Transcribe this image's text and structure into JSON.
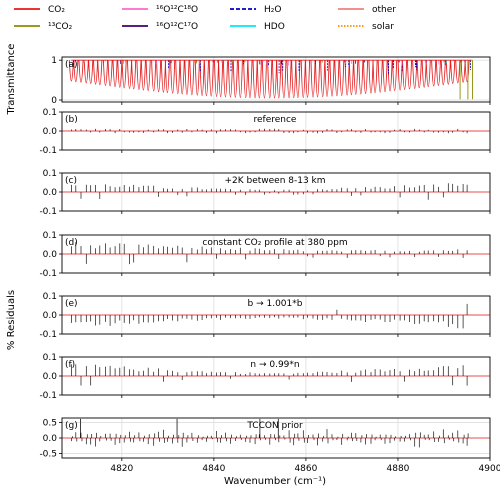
{
  "chart_data": {
    "type": "line",
    "legend": {
      "position": "top",
      "entries": [
        {
          "label": "CO₂",
          "color": "#e41a1c",
          "style": "solid"
        },
        {
          "label": "¹³CO₂",
          "color": "#8c8c00",
          "style": "solid"
        },
        {
          "label": "¹⁶O¹²C¹⁸O",
          "color": "#ff66cc",
          "style": "solid"
        },
        {
          "label": "¹⁶O¹²C¹⁷O",
          "color": "#3b006f",
          "style": "solid"
        },
        {
          "label": "H₂O",
          "color": "#0000cc",
          "style": "dashed"
        },
        {
          "label": "HDO",
          "color": "#00e5ff",
          "style": "solid"
        },
        {
          "label": "other",
          "color": "#f08080",
          "style": "solid"
        },
        {
          "label": "solar",
          "color": "#ff8c00",
          "style": "dotted"
        }
      ]
    },
    "xlabel": "Wavenumber (cm⁻¹)",
    "xlim": [
      4807,
      4900
    ],
    "xticks": [
      4820,
      4840,
      4860,
      4880,
      4900
    ],
    "shared_ylabel": "% Residuals",
    "band": [
      4809,
      4896
    ],
    "panels": [
      {
        "letter": "(a)",
        "title": "",
        "ylabel": "Transmittance",
        "ylim": [
          -0.05,
          1.08
        ],
        "yticks": [
          0,
          1
        ],
        "kind": "transmittance"
      },
      {
        "letter": "(b)",
        "title": "reference",
        "ylim": [
          -0.1,
          0.1
        ],
        "yticks": [
          -0.1,
          0.0,
          0.1
        ],
        "amp": 0.012,
        "trend": "flat",
        "neg": 0.5
      },
      {
        "letter": "(c)",
        "title": "+2K between 8-13 km",
        "ylim": [
          -0.1,
          0.1
        ],
        "yticks": [
          -0.1,
          0.0,
          0.1
        ],
        "amp": 0.055,
        "trend": "edges",
        "neg": 0.2
      },
      {
        "letter": "(d)",
        "title": "constant CO₂ profile at 380 ppm",
        "ylim": [
          -0.1,
          0.1
        ],
        "yticks": [
          -0.1,
          0.0,
          0.1
        ],
        "amp": 0.065,
        "trend": "left",
        "neg": 0.2
      },
      {
        "letter": "(e)",
        "title": "b → 1.001*b",
        "ylim": [
          -0.1,
          0.1
        ],
        "yticks": [
          -0.1,
          0.0,
          0.1
        ],
        "amp": 0.075,
        "trend": "edges",
        "neg": 0.95
      },
      {
        "letter": "(f)",
        "title": "n → 0.99*n",
        "ylim": [
          -0.1,
          0.1
        ],
        "yticks": [
          -0.1,
          0.0,
          0.1
        ],
        "amp": 0.07,
        "trend": "edges",
        "neg": 0.1
      },
      {
        "letter": "(g)",
        "title": "TCCON prior",
        "ylim": [
          -0.65,
          0.65
        ],
        "yticks": [
          -0.5,
          0.0,
          0.5
        ],
        "amp": 0.45,
        "trend": "noisy",
        "neg": 0.6
      }
    ]
  }
}
